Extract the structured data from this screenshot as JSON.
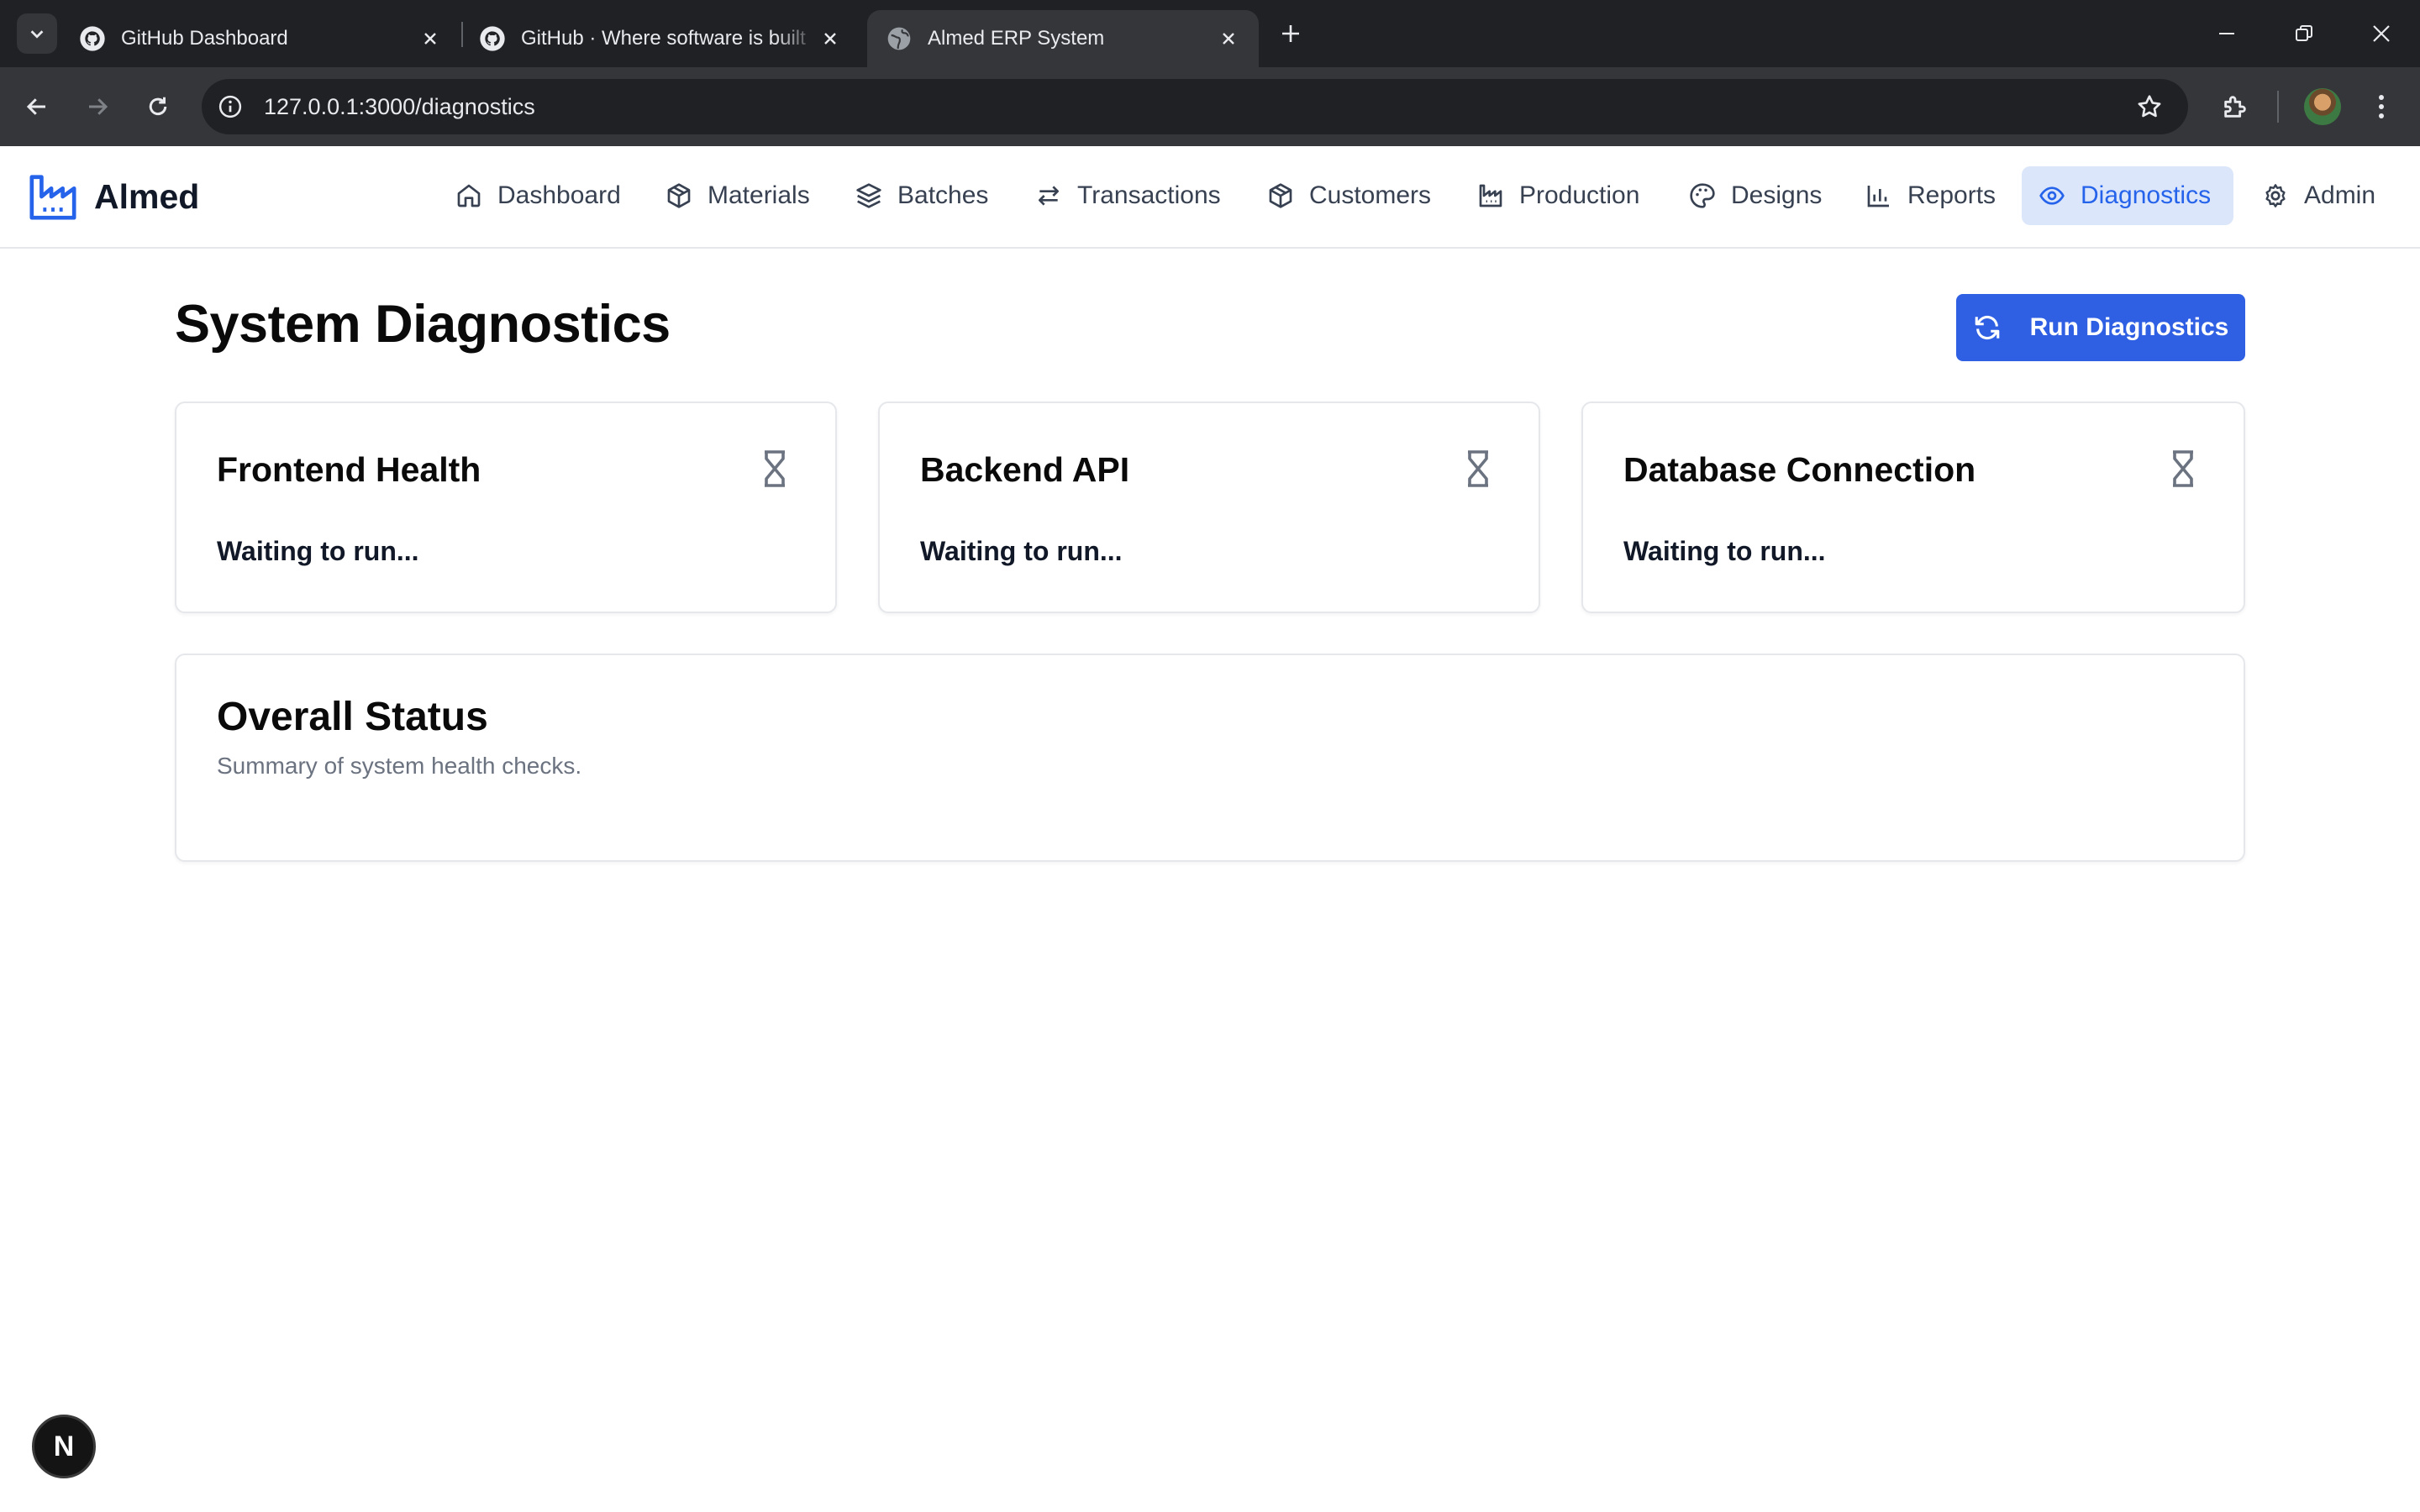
{
  "browser": {
    "tabs": [
      {
        "title": "GitHub Dashboard",
        "icon": "github-icon"
      },
      {
        "title": "GitHub · Where software is built",
        "icon": "github-icon"
      },
      {
        "title": "Almed ERP System",
        "icon": "globe-icon",
        "active": true
      }
    ],
    "url": "127.0.0.1:3000/diagnostics"
  },
  "app": {
    "brand": "Almed",
    "accent_color": "#2f5fe3",
    "nav": [
      {
        "label": "Dashboard",
        "icon": "home-icon"
      },
      {
        "label": "Materials",
        "icon": "package-icon"
      },
      {
        "label": "Batches",
        "icon": "layers-icon"
      },
      {
        "label": "Transactions",
        "icon": "arrows-icon"
      },
      {
        "label": "Customers",
        "icon": "package-icon"
      },
      {
        "label": "Production",
        "icon": "factory-icon"
      },
      {
        "label": "Designs",
        "icon": "palette-icon"
      },
      {
        "label": "Reports",
        "icon": "bar-chart-icon"
      },
      {
        "label": "Diagnostics",
        "icon": "eye-icon",
        "active": true
      },
      {
        "label": "Admin",
        "icon": "gear-icon"
      }
    ]
  },
  "page": {
    "title": "System Diagnostics",
    "run_button": "Run Diagnostics",
    "checks": [
      {
        "title": "Frontend Health",
        "status": "Waiting to run...",
        "icon": "hourglass-icon"
      },
      {
        "title": "Backend API",
        "status": "Waiting to run...",
        "icon": "hourglass-icon"
      },
      {
        "title": "Database Connection",
        "status": "Waiting to run...",
        "icon": "hourglass-icon"
      }
    ],
    "overall": {
      "title": "Overall Status",
      "subtitle": "Summary of system health checks."
    }
  },
  "dev_badge": "N"
}
